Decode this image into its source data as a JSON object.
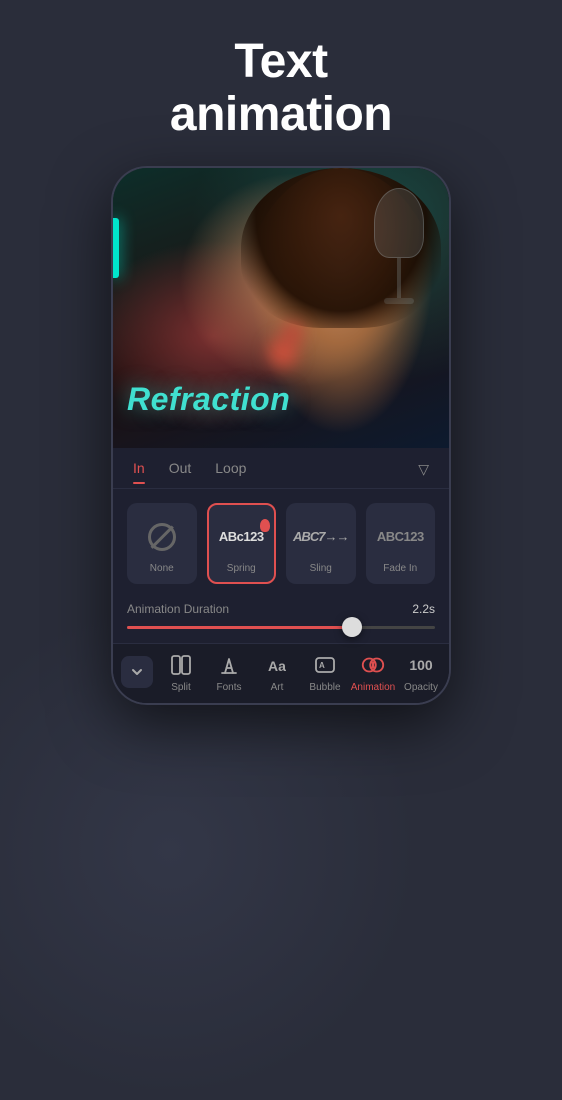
{
  "header": {
    "title_line1": "Text",
    "title_line2": "animation"
  },
  "tabs": {
    "items": [
      {
        "id": "in",
        "label": "In",
        "active": true
      },
      {
        "id": "out",
        "label": "Out",
        "active": false
      },
      {
        "id": "loop",
        "label": "Loop",
        "active": false
      }
    ],
    "dropdown_icon": "▽"
  },
  "animation_options": [
    {
      "id": "none",
      "label": "None",
      "icon_type": "none",
      "selected": false
    },
    {
      "id": "spring",
      "label": "Spring",
      "icon_text": "ABc123",
      "selected": true
    },
    {
      "id": "sling",
      "label": "Sling",
      "icon_text": "ABC7→→",
      "selected": false
    },
    {
      "id": "fade_in",
      "label": "Fade In",
      "icon_text": "ABC123",
      "selected": false
    }
  ],
  "duration": {
    "label": "Animation Duration",
    "value": "2.2s",
    "fill_percent": 73
  },
  "overlay_text": "Refraction",
  "toolbar": {
    "items": [
      {
        "id": "split",
        "label": "Split",
        "icon": "split"
      },
      {
        "id": "fonts",
        "label": "Fonts",
        "icon": "fonts"
      },
      {
        "id": "art",
        "label": "Art",
        "icon": "art"
      },
      {
        "id": "bubble",
        "label": "Bubble",
        "icon": "bubble"
      },
      {
        "id": "animation",
        "label": "Animation",
        "icon": "animation",
        "active": true
      },
      {
        "id": "opacity",
        "label": "Opacity",
        "value": "100",
        "icon": "opacity"
      }
    ]
  }
}
